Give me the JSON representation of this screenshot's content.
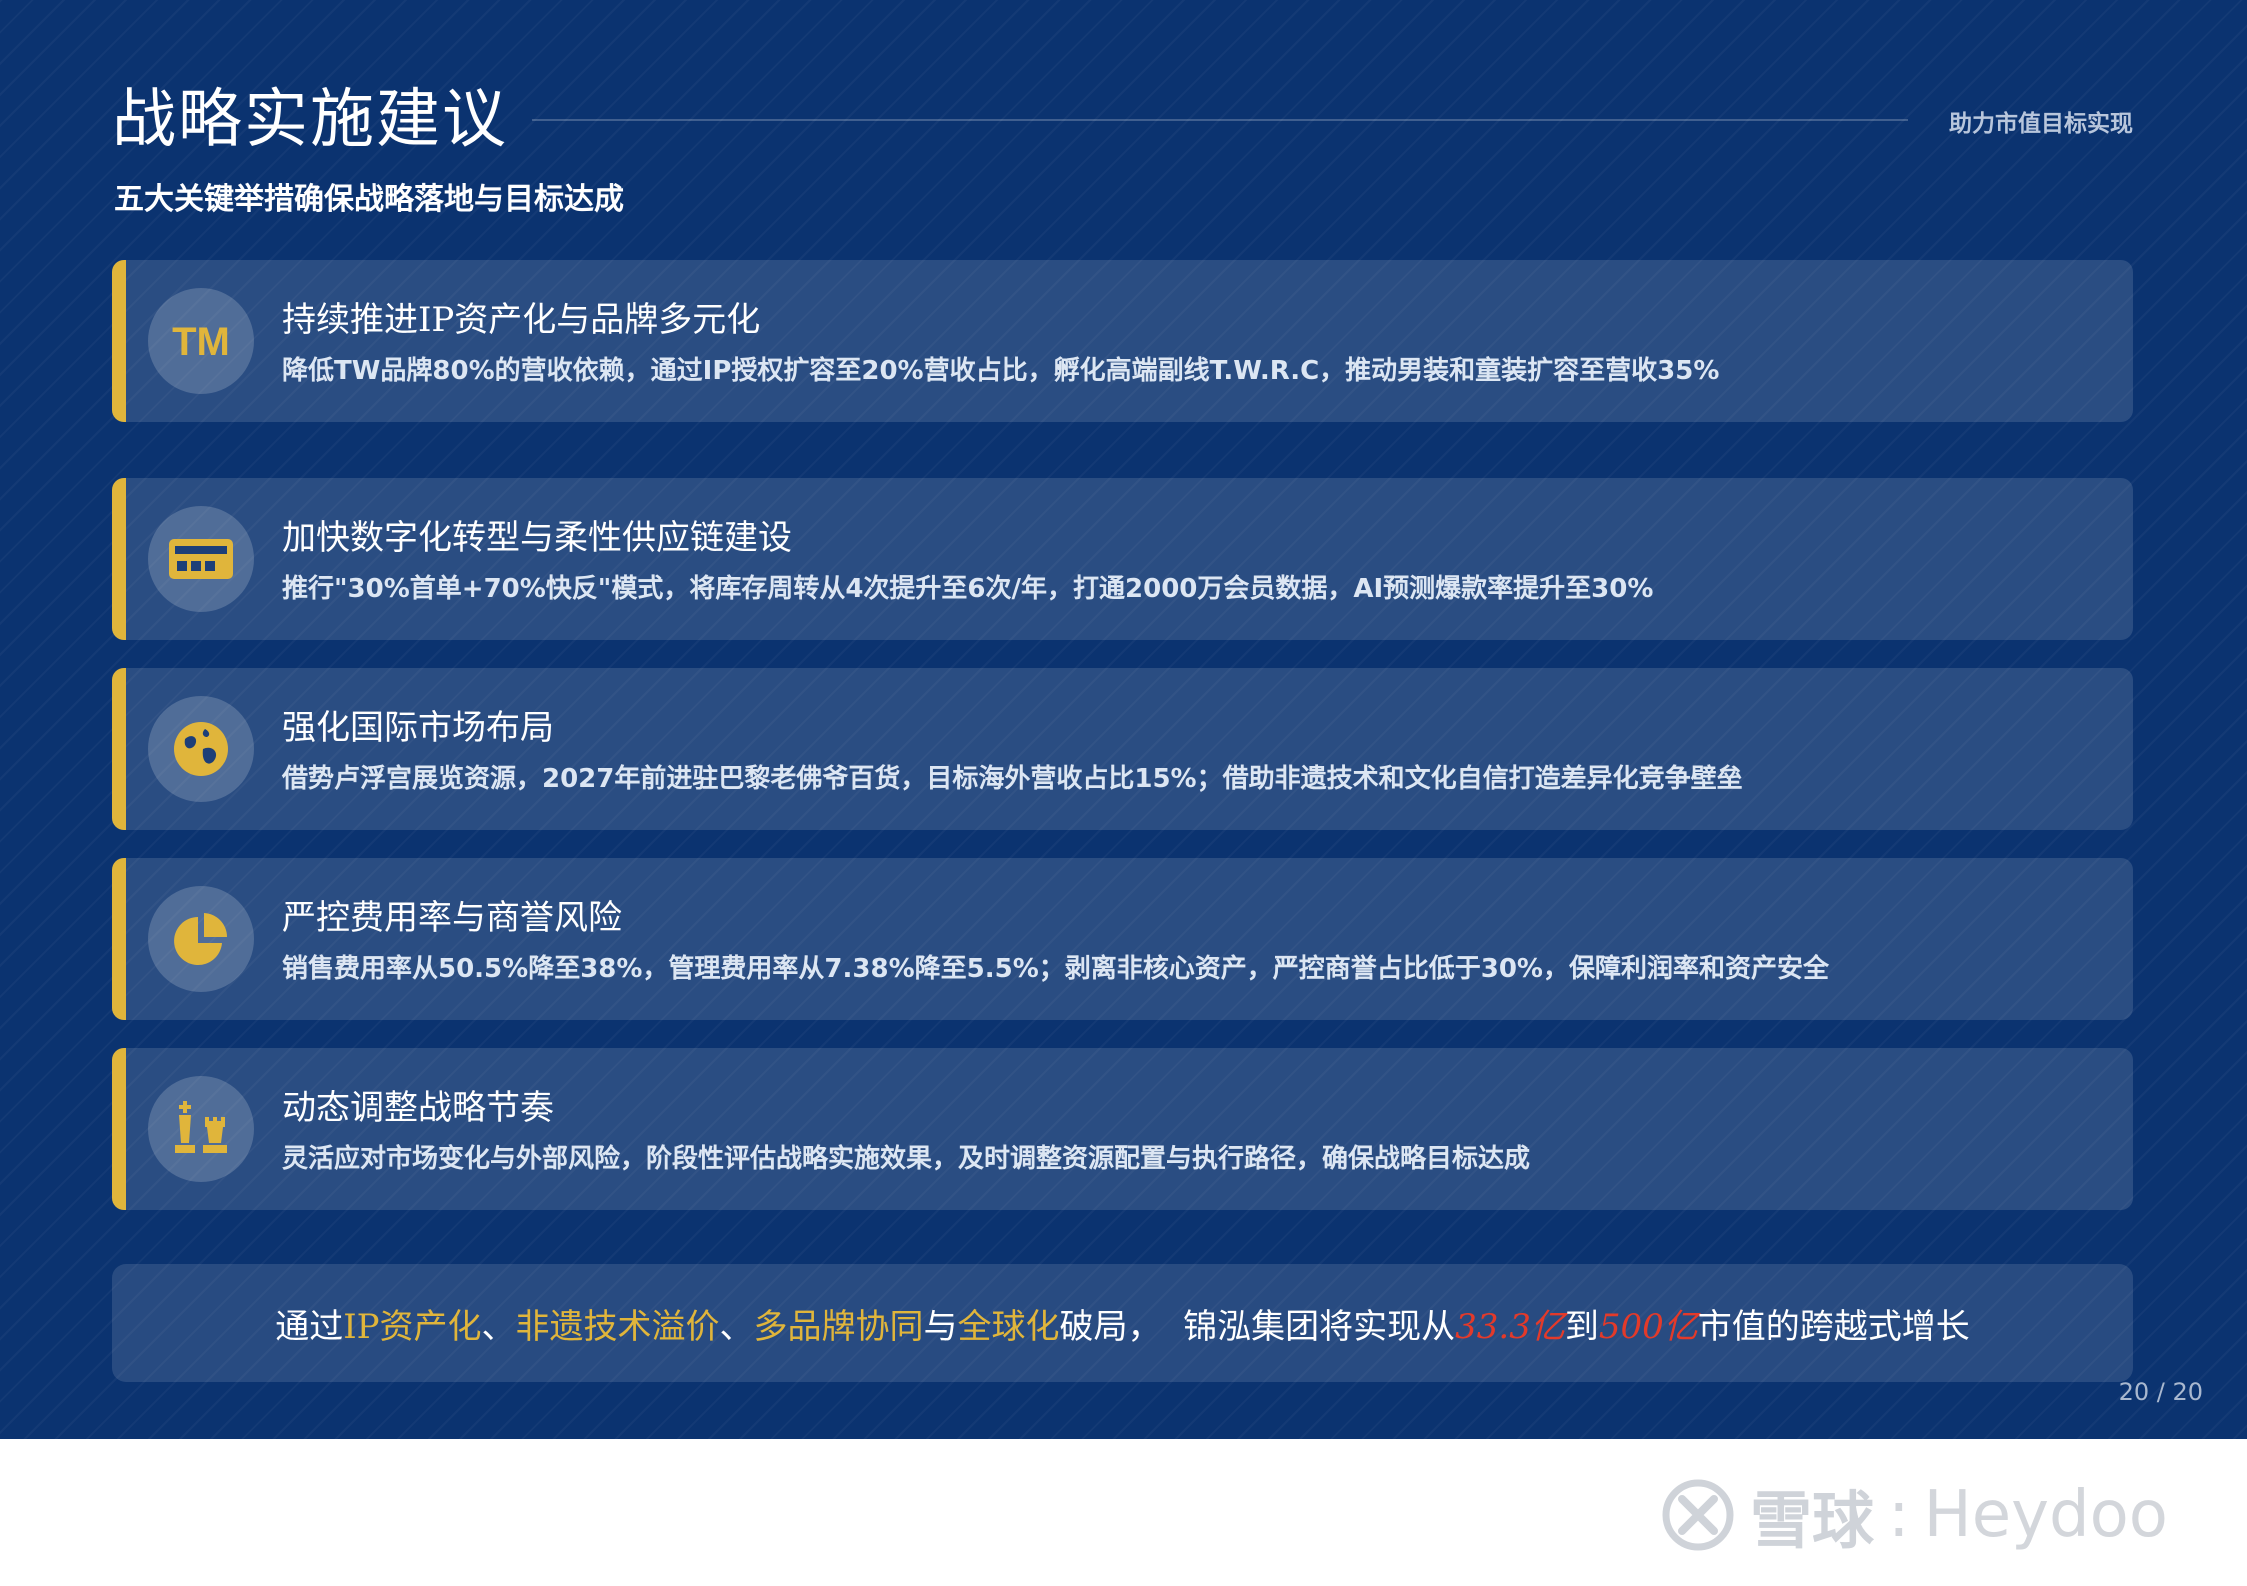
{
  "slide": {
    "title": "战略实施建议",
    "tagline": "助力市值目标实现",
    "subtitle": "五大关键举措确保战略落地与目标达成",
    "accent_color": "#e0b53b",
    "background_color": "#0b3370"
  },
  "items": [
    {
      "icon": "trademark-icon",
      "title": "持续推进IP资产化与品牌多元化",
      "text": "降低TW品牌80%的营收依赖，通过IP授权扩容至20%营收占比，孵化高端副线T.W.R.C，推动男装和童装扩容至营收35%"
    },
    {
      "icon": "card-chip-icon",
      "title": "加快数字化转型与柔性供应链建设",
      "text": "推行\"30%首单+70%快反\"模式，将库存周转从4次提升至6次/年，打通2000万会员数据，AI预测爆款率提升至30%"
    },
    {
      "icon": "globe-icon",
      "title": "强化国际市场布局",
      "text": "借势卢浮宫展览资源，2027年前进驻巴黎老佛爷百货，目标海外营收占比15%；借助非遗技术和文化自信打造差异化竞争壁垒"
    },
    {
      "icon": "pie-chart-icon",
      "title": "严控费用率与商誉风险",
      "text": "销售费用率从50.5%降至38%，管理费用率从7.38%降至5.5%；剥离非核心资产，严控商誉占比低于30%，保障利润率和资产安全"
    },
    {
      "icon": "chess-icon",
      "title": "动态调整战略节奏",
      "text": "灵活应对市场变化与外部风险，阶段性评估战略实施效果，及时调整资源配置与执行路径，确保战略目标达成"
    }
  ],
  "summary": {
    "p1": "通过",
    "h1": "IP资产化",
    "p2": "、",
    "h2": "非遗技术溢价",
    "p3": "、",
    "h3": "多品牌协同",
    "p4": "与",
    "h4": "全球化",
    "p5": "破局，  锦泓集团将实现从",
    "r1": "33.3亿",
    "p6": "到",
    "r2": "500亿",
    "p7": "市值的跨越式增长"
  },
  "page_number": "20 / 20",
  "watermark": {
    "brand_cn": "雪球",
    "separator": ":",
    "author": "Heydoo"
  }
}
